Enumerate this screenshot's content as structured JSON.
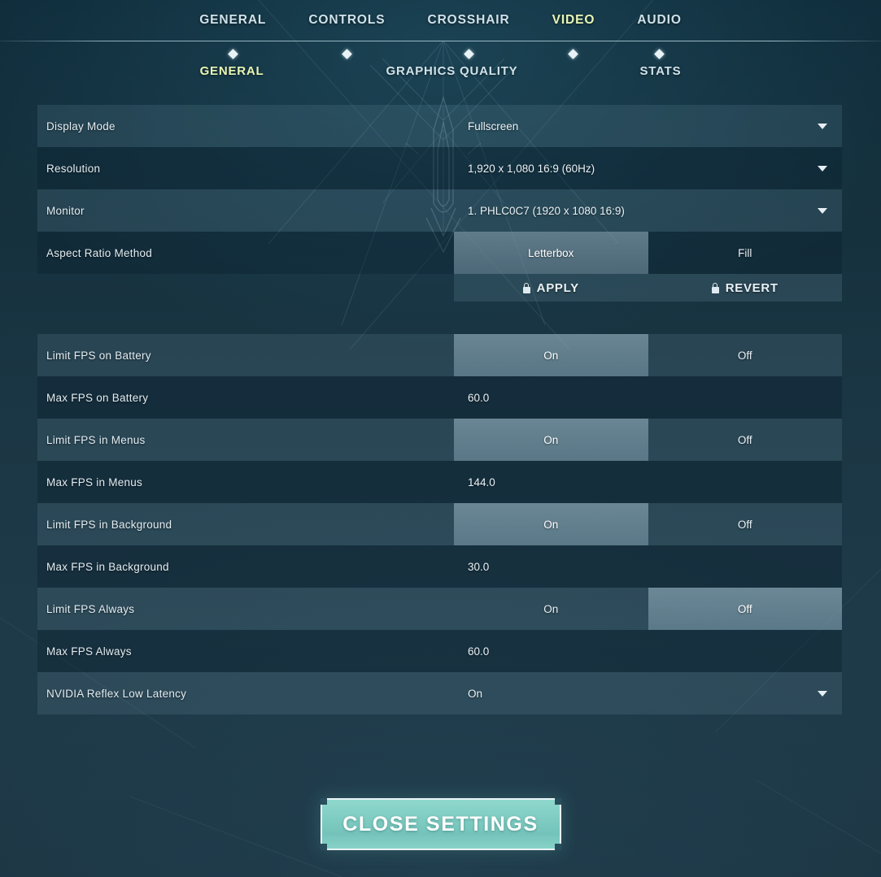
{
  "header": {
    "tabs": [
      {
        "label": "GENERAL",
        "active": false
      },
      {
        "label": "CONTROLS",
        "active": false
      },
      {
        "label": "CROSSHAIR",
        "active": false
      },
      {
        "label": "VIDEO",
        "active": true
      },
      {
        "label": "AUDIO",
        "active": false
      }
    ],
    "subtabs": [
      {
        "label": "GENERAL",
        "active": true
      },
      {
        "label": "GRAPHICS QUALITY",
        "active": false
      },
      {
        "label": "STATS",
        "active": false
      }
    ]
  },
  "settings": {
    "display_mode": {
      "label": "Display Mode",
      "value": "Fullscreen",
      "type": "dropdown"
    },
    "resolution": {
      "label": "Resolution",
      "value": "1,920 x 1,080 16:9 (60Hz)",
      "type": "dropdown"
    },
    "monitor": {
      "label": "Monitor",
      "value": "1. PHLC0C7 (1920 x  1080 16:9)",
      "type": "dropdown"
    },
    "aspect_ratio_method": {
      "label": "Aspect Ratio Method",
      "options": [
        "Letterbox",
        "Fill"
      ],
      "selected": "Letterbox",
      "type": "toggle"
    },
    "apply": {
      "label": "APPLY",
      "icon": "lock-icon"
    },
    "revert": {
      "label": "REVERT",
      "icon": "lock-icon"
    },
    "limit_fps_on_battery": {
      "label": "Limit FPS on Battery",
      "options": [
        "On",
        "Off"
      ],
      "selected": "On",
      "type": "toggle"
    },
    "max_fps_on_battery": {
      "label": "Max FPS on Battery",
      "value": "60.0",
      "type": "text"
    },
    "limit_fps_in_menus": {
      "label": "Limit FPS in Menus",
      "options": [
        "On",
        "Off"
      ],
      "selected": "On",
      "type": "toggle"
    },
    "max_fps_in_menus": {
      "label": "Max FPS in Menus",
      "value": "144.0",
      "type": "text"
    },
    "limit_fps_in_background": {
      "label": "Limit FPS in Background",
      "options": [
        "On",
        "Off"
      ],
      "selected": "On",
      "type": "toggle"
    },
    "max_fps_in_background": {
      "label": "Max FPS in Background",
      "value": "30.0",
      "type": "text"
    },
    "limit_fps_always": {
      "label": "Limit FPS Always",
      "options": [
        "On",
        "Off"
      ],
      "selected": "Off",
      "type": "toggle"
    },
    "max_fps_always": {
      "label": "Max FPS Always",
      "value": "60.0",
      "type": "text"
    },
    "nvidia_reflex_low_latency": {
      "label": "NVIDIA Reflex Low Latency",
      "value": "On",
      "type": "dropdown"
    }
  },
  "footer": {
    "close_label": "CLOSE SETTINGS"
  },
  "colors": {
    "background": "#1b3644",
    "accent_active_tab": "#e9f6b5",
    "text_primary": "#e3edf2",
    "row_highlight": "#5f7382",
    "close_button": "#7fccc2",
    "close_button_border": "#e9f3f6"
  }
}
